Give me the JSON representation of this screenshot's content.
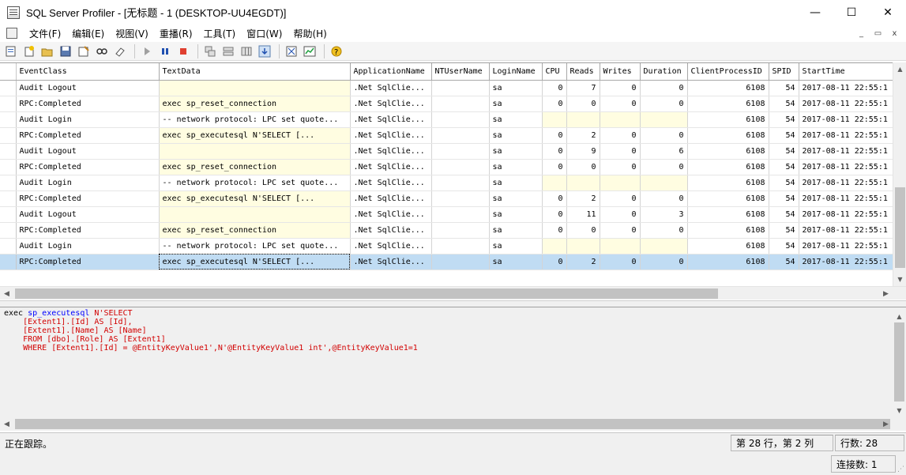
{
  "window": {
    "title": "SQL Server Profiler - [无标题 - 1 (DESKTOP-UU4EGDT)]",
    "minimize_glyph": "—",
    "maximize_glyph": "☐",
    "close_glyph": "✕"
  },
  "menu": {
    "items": [
      "文件(F)",
      "编辑(E)",
      "视图(V)",
      "重播(R)",
      "工具(T)",
      "窗口(W)",
      "帮助(H)"
    ],
    "mdi": [
      "_",
      "▭",
      "x"
    ]
  },
  "toolbar": {
    "buttons": [
      "new-trace-icon",
      "new-template-icon",
      "open-icon",
      "save-icon",
      "properties-icon",
      "find-icon",
      "clear-icon",
      "start-icon",
      "pause-icon",
      "stop-icon",
      "cascade-icon",
      "tile-icon",
      "columns-icon",
      "autoscroll-icon",
      "template-props-icon",
      "perfmon-icon",
      "help-icon"
    ]
  },
  "grid": {
    "columns": [
      "EventClass",
      "TextData",
      "ApplicationName",
      "NTUserName",
      "LoginName",
      "CPU",
      "Reads",
      "Writes",
      "Duration",
      "ClientProcessID",
      "SPID",
      "StartTime"
    ],
    "rows": [
      {
        "event": "Audit Logout",
        "text": "",
        "app": ".Net SqlClie...",
        "nt": "",
        "login": "sa",
        "cpu": "0",
        "reads": "7",
        "writes": "0",
        "duration": "0",
        "pid": "6108",
        "spid": "54",
        "start": "2017-08-11 22:55:1",
        "yel_text": true,
        "yel_perf": false
      },
      {
        "event": "RPC:Completed",
        "text": "exec sp_reset_connection",
        "app": ".Net SqlClie...",
        "nt": "",
        "login": "sa",
        "cpu": "0",
        "reads": "0",
        "writes": "0",
        "duration": "0",
        "pid": "6108",
        "spid": "54",
        "start": "2017-08-11 22:55:1",
        "yel_text": true,
        "yel_perf": false
      },
      {
        "event": "Audit Login",
        "text": "-- network protocol: LPC  set quote...",
        "app": ".Net SqlClie...",
        "nt": "",
        "login": "sa",
        "cpu": "",
        "reads": "",
        "writes": "",
        "duration": "",
        "pid": "6108",
        "spid": "54",
        "start": "2017-08-11 22:55:1",
        "yel_text": false,
        "yel_perf": true
      },
      {
        "event": "RPC:Completed",
        "text": "exec sp_executesql N'SELECT       [...",
        "app": ".Net SqlClie...",
        "nt": "",
        "login": "sa",
        "cpu": "0",
        "reads": "2",
        "writes": "0",
        "duration": "0",
        "pid": "6108",
        "spid": "54",
        "start": "2017-08-11 22:55:1",
        "yel_text": true,
        "yel_perf": false
      },
      {
        "event": "Audit Logout",
        "text": "",
        "app": ".Net SqlClie...",
        "nt": "",
        "login": "sa",
        "cpu": "0",
        "reads": "9",
        "writes": "0",
        "duration": "6",
        "pid": "6108",
        "spid": "54",
        "start": "2017-08-11 22:55:1",
        "yel_text": true,
        "yel_perf": false
      },
      {
        "event": "RPC:Completed",
        "text": "exec sp_reset_connection",
        "app": ".Net SqlClie...",
        "nt": "",
        "login": "sa",
        "cpu": "0",
        "reads": "0",
        "writes": "0",
        "duration": "0",
        "pid": "6108",
        "spid": "54",
        "start": "2017-08-11 22:55:1",
        "yel_text": true,
        "yel_perf": false
      },
      {
        "event": "Audit Login",
        "text": "-- network protocol: LPC  set quote...",
        "app": ".Net SqlClie...",
        "nt": "",
        "login": "sa",
        "cpu": "",
        "reads": "",
        "writes": "",
        "duration": "",
        "pid": "6108",
        "spid": "54",
        "start": "2017-08-11 22:55:1",
        "yel_text": false,
        "yel_perf": true
      },
      {
        "event": "RPC:Completed",
        "text": "exec sp_executesql N'SELECT       [...",
        "app": ".Net SqlClie...",
        "nt": "",
        "login": "sa",
        "cpu": "0",
        "reads": "2",
        "writes": "0",
        "duration": "0",
        "pid": "6108",
        "spid": "54",
        "start": "2017-08-11 22:55:1",
        "yel_text": true,
        "yel_perf": false
      },
      {
        "event": "Audit Logout",
        "text": "",
        "app": ".Net SqlClie...",
        "nt": "",
        "login": "sa",
        "cpu": "0",
        "reads": "11",
        "writes": "0",
        "duration": "3",
        "pid": "6108",
        "spid": "54",
        "start": "2017-08-11 22:55:1",
        "yel_text": true,
        "yel_perf": false
      },
      {
        "event": "RPC:Completed",
        "text": "exec sp_reset_connection",
        "app": ".Net SqlClie...",
        "nt": "",
        "login": "sa",
        "cpu": "0",
        "reads": "0",
        "writes": "0",
        "duration": "0",
        "pid": "6108",
        "spid": "54",
        "start": "2017-08-11 22:55:1",
        "yel_text": true,
        "yel_perf": false
      },
      {
        "event": "Audit Login",
        "text": "-- network protocol: LPC  set quote...",
        "app": ".Net SqlClie...",
        "nt": "",
        "login": "sa",
        "cpu": "",
        "reads": "",
        "writes": "",
        "duration": "",
        "pid": "6108",
        "spid": "54",
        "start": "2017-08-11 22:55:1",
        "yel_text": false,
        "yel_perf": true
      },
      {
        "event": "RPC:Completed",
        "text": "exec sp_executesql N'SELECT       [...",
        "app": ".Net SqlClie...",
        "nt": "",
        "login": "sa",
        "cpu": "0",
        "reads": "2",
        "writes": "0",
        "duration": "0",
        "pid": "6108",
        "spid": "54",
        "start": "2017-08-11 22:55:1",
        "yel_text": true,
        "yel_perf": false,
        "selected": true
      }
    ]
  },
  "detail": {
    "lines": [
      {
        "prefix": "exec ",
        "kw": "sp_executesql",
        "rest": " N'SELECT"
      },
      {
        "prefix": "    ",
        "kw": "",
        "rest": "[Extent1].[Id] AS [Id],"
      },
      {
        "prefix": "    ",
        "kw": "",
        "rest": "[Extent1].[Name] AS [Name]"
      },
      {
        "prefix": "    ",
        "kw": "",
        "rest": "FROM [dbo].[Role] AS [Extent1]"
      },
      {
        "prefix": "    ",
        "kw": "",
        "rest": "WHERE [Extent1].[Id] = @EntityKeyValue1',N'@EntityKeyValue1 int',@EntityKeyValue1=1"
      }
    ]
  },
  "status": {
    "left": "正在跟踪。",
    "position": "第 28 行，第 2 列",
    "rows": "行数: 28",
    "connections": "连接数: 1"
  }
}
